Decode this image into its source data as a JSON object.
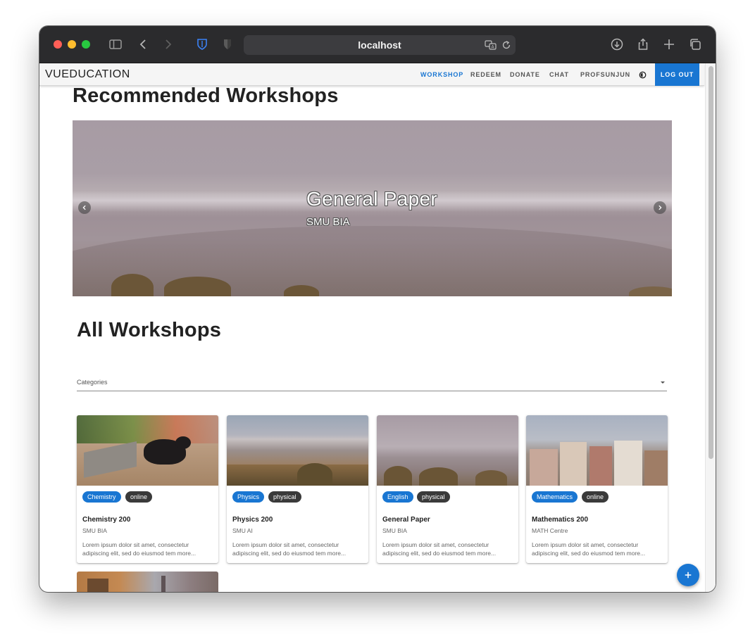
{
  "browser": {
    "url": "localhost",
    "icons": [
      "sidebar-icon",
      "back-icon",
      "forward-icon",
      "bitwarden-icon",
      "privacy-shield-icon",
      "translate-icon",
      "reload-icon",
      "download-icon",
      "share-icon",
      "new-tab-icon",
      "tabs-overview-icon"
    ]
  },
  "app": {
    "brand": "VUEDUCATION",
    "nav": [
      {
        "label": "WORKSHOP",
        "active": true
      },
      {
        "label": "REDEEM",
        "active": false
      },
      {
        "label": "DONATE",
        "active": false
      },
      {
        "label": "CHAT",
        "active": false
      },
      {
        "label": "PROFSUNJUN",
        "active": false
      }
    ],
    "logout_label": "LOG OUT",
    "accent": "#1976d2"
  },
  "recommended": {
    "heading": "Recommended Workshops",
    "slide": {
      "title": "General Paper",
      "subtitle": "SMU BIA"
    }
  },
  "all": {
    "heading": "All Workshops",
    "categories_label": "Categories"
  },
  "workshops": [
    {
      "title": "Chemistry 200",
      "org": "SMU BIA",
      "subject": "Chemistry",
      "mode": "online",
      "description": "Lorem ipsum dolor sit amet, consectetur adipiscing elit, sed do eiusmod tem more..."
    },
    {
      "title": "Physics 200",
      "org": "SMU AI",
      "subject": "Physics",
      "mode": "physical",
      "description": "Lorem ipsum dolor sit amet, consectetur adipiscing elit, sed do eiusmod tem more..."
    },
    {
      "title": "General Paper",
      "org": "SMU BIA",
      "subject": "English",
      "mode": "physical",
      "description": "Lorem ipsum dolor sit amet, consectetur adipiscing elit, sed do eiusmod tem more..."
    },
    {
      "title": "Mathematics 200",
      "org": "MATH Centre",
      "subject": "Mathematics",
      "mode": "online",
      "description": "Lorem ipsum dolor sit amet, consectetur adipiscing elit, sed do eiusmod tem more..."
    }
  ]
}
